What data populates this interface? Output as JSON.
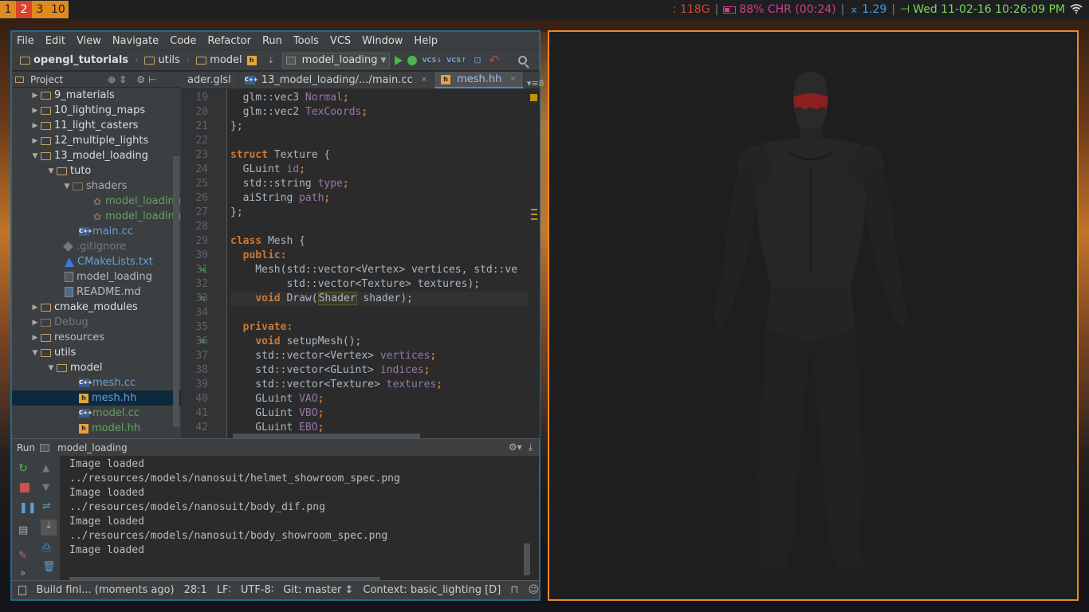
{
  "topbar": {
    "workspaces": [
      "1",
      "2",
      "3",
      "10"
    ],
    "active_workspace": "2",
    "memory": ": 118G",
    "battery": "88% CHR (00:24)",
    "load": "1.29",
    "datetime": "Wed 11-02-16 10:26:09 PM"
  },
  "ide": {
    "menu": [
      "File",
      "Edit",
      "View",
      "Navigate",
      "Code",
      "Refactor",
      "Run",
      "Tools",
      "VCS",
      "Window",
      "Help"
    ],
    "breadcrumb": [
      "opengl_tutorials",
      "utils",
      "model"
    ],
    "run_config": "model_loading",
    "project_label": "Project",
    "tabs": [
      {
        "label": "ader.glsl"
      },
      {
        "label": "13_model_loading/.../main.cc"
      },
      {
        "label": "mesh.hh"
      }
    ],
    "tree": [
      {
        "label": "9_materials"
      },
      {
        "label": "10_lighting_maps"
      },
      {
        "label": "11_light_casters"
      },
      {
        "label": "12_multiple_lights"
      },
      {
        "label": "13_model_loading"
      },
      {
        "label": "tuto"
      },
      {
        "label": "shaders"
      },
      {
        "label": "model_loading"
      },
      {
        "label": "model_loading"
      },
      {
        "label": "main.cc"
      },
      {
        "label": ".gitignore"
      },
      {
        "label": "CMakeLists.txt"
      },
      {
        "label": "model_loading"
      },
      {
        "label": "README.md"
      },
      {
        "label": "cmake_modules"
      },
      {
        "label": "Debug"
      },
      {
        "label": "resources"
      },
      {
        "label": "utils"
      },
      {
        "label": "model"
      },
      {
        "label": "mesh.cc"
      },
      {
        "label": "mesh.hh"
      },
      {
        "label": "model.cc"
      },
      {
        "label": "model.hh"
      }
    ],
    "line_numbers": [
      "19",
      "20",
      "21",
      "22",
      "23",
      "24",
      "25",
      "26",
      "27",
      "28",
      "29",
      "30",
      "31",
      "32",
      "33",
      "34",
      "35",
      "36",
      "37",
      "38",
      "39",
      "40",
      "41",
      "42"
    ],
    "code": {
      "l19a": "  glm::vec3 ",
      "l19b": "Normal",
      "l19c": ";",
      "l20a": "  glm::vec2 ",
      "l20b": "TexCoords",
      "l20c": ";",
      "l21": "};",
      "l23a": "struct",
      "l23b": " Texture {",
      "l24a": "  GLuint ",
      "l24b": "id",
      "l24c": ";",
      "l25a": "  std::string ",
      "l25b": "type",
      "l25c": ";",
      "l26a": "  aiString ",
      "l26b": "path",
      "l26c": ";",
      "l27": "};",
      "l29a": "class",
      "l29b": " Mesh {",
      "l30a": "  public",
      "l30b": ":",
      "l31": "    Mesh(std::vector<Vertex> vertices, std::ve",
      "l32": "         std::vector<Texture> textures);",
      "l33a": "    ",
      "l33b": "void",
      "l33c": " Draw(",
      "l33d": "Shader",
      "l33e": " shader);",
      "l35a": "  private",
      "l35b": ":",
      "l36a": "    ",
      "l36b": "void",
      "l36c": " setupMesh();",
      "l37a": "    std::vector<Vertex> ",
      "l37b": "vertices",
      "l37c": ";",
      "l38a": "    std::vector<GLuint> ",
      "l38b": "indices",
      "l38c": ";",
      "l39a": "    std::vector<Texture> ",
      "l39b": "textures",
      "l39c": ";",
      "l40a": "    GLuint ",
      "l40b": "VAO",
      "l40c": ";",
      "l41a": "    GLuint ",
      "l41b": "VBO",
      "l41c": ";",
      "l42a": "    GLuint ",
      "l42b": "EBO",
      "l42c": ";"
    },
    "run_label": "Run",
    "run_target": "model_loading",
    "console": [
      "Image loaded",
      "../resources/models/nanosuit/helmet_showroom_spec.png",
      "Image loaded",
      "../resources/models/nanosuit/body_dif.png",
      "Image loaded",
      "../resources/models/nanosuit/body_showroom_spec.png",
      "Image loaded"
    ],
    "status": {
      "build": "Build fini... (moments ago)",
      "position": "28:1",
      "line_ending": "LF∶",
      "encoding": "UTF-8∶",
      "git": "Git: master ↕",
      "context": "Context: basic_lighting [D]"
    }
  },
  "colors": {
    "ide_border": "#1d6b92",
    "render_border": "#e8892a",
    "keyword": "#cc7832",
    "field": "#9876aa"
  }
}
